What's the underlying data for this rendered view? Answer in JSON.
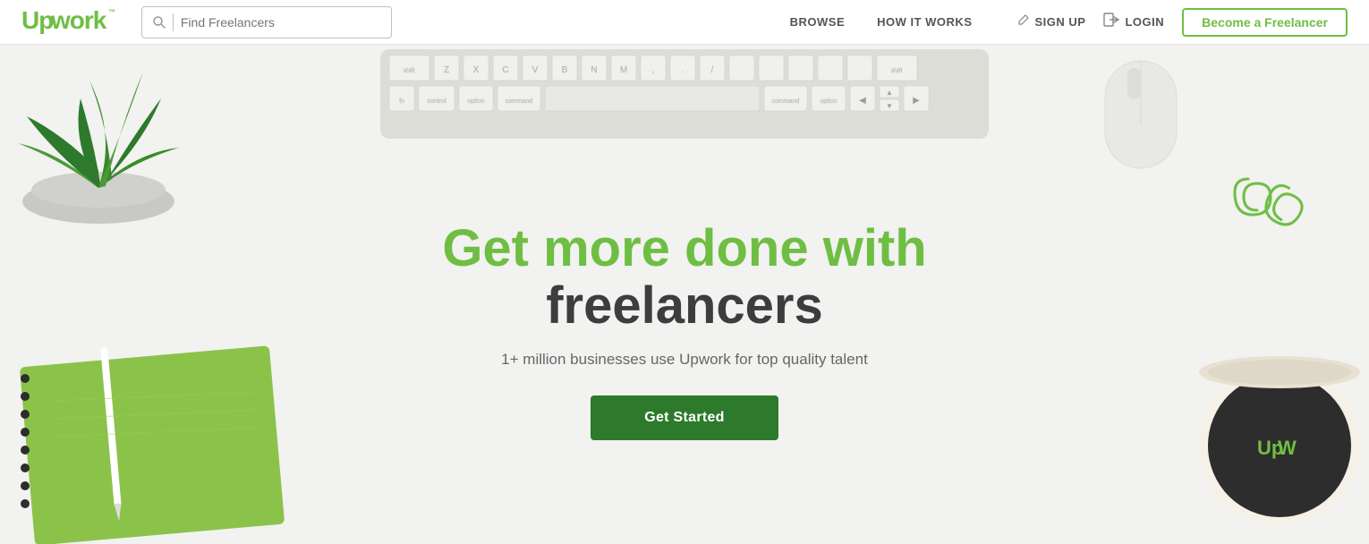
{
  "header": {
    "logo": "upwork",
    "logo_tm": "TM",
    "search_placeholder": "Find Freelancers",
    "search_dropdown": "▾",
    "nav": {
      "browse": "BROWSE",
      "how_it_works": "HOW IT WORKS"
    },
    "actions": {
      "signup": "SIGN UP",
      "login": "LOGIN",
      "become_freelancer": "Become a Freelancer"
    }
  },
  "hero": {
    "title_line1": "Get more done with",
    "title_line2": "freelancers",
    "subtitle": "1+ million businesses use Upwork for top quality talent",
    "cta_button": "Get Started"
  },
  "colors": {
    "green": "#6fbe44",
    "dark_green": "#2d7a2d",
    "dark_text": "#3d3d3d",
    "muted_text": "#666"
  }
}
